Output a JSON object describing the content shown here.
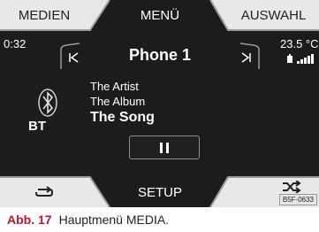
{
  "top_menu": {
    "left": "MEDIEN",
    "center": "MENÜ",
    "right": "AUSWAHL"
  },
  "bottom_menu": {
    "center": "SETUP"
  },
  "status": {
    "time": "0:32",
    "temperature": "23.5 °C"
  },
  "source": {
    "title": "Phone 1",
    "bluetooth_label": "BT"
  },
  "track": {
    "artist": "The Artist",
    "album": "The Album",
    "song": "The Song"
  },
  "image_code": "B5F-0633",
  "caption": {
    "label": "Abb. 17",
    "text": "Hauptmenü MEDIA."
  },
  "icons": {
    "prev": "skip-previous-icon",
    "next": "skip-next-icon",
    "pause": "pause-icon",
    "repeat": "repeat-icon",
    "shuffle": "shuffle-icon",
    "bluetooth": "bluetooth-icon",
    "signal": "signal-strength-icon",
    "phone": "phone-battery-icon"
  },
  "colors": {
    "screen_bg": "#1c1c1c",
    "bar_bg": "#e2e2e2",
    "text": "#ffffff",
    "caption_label": "#c8102e"
  }
}
